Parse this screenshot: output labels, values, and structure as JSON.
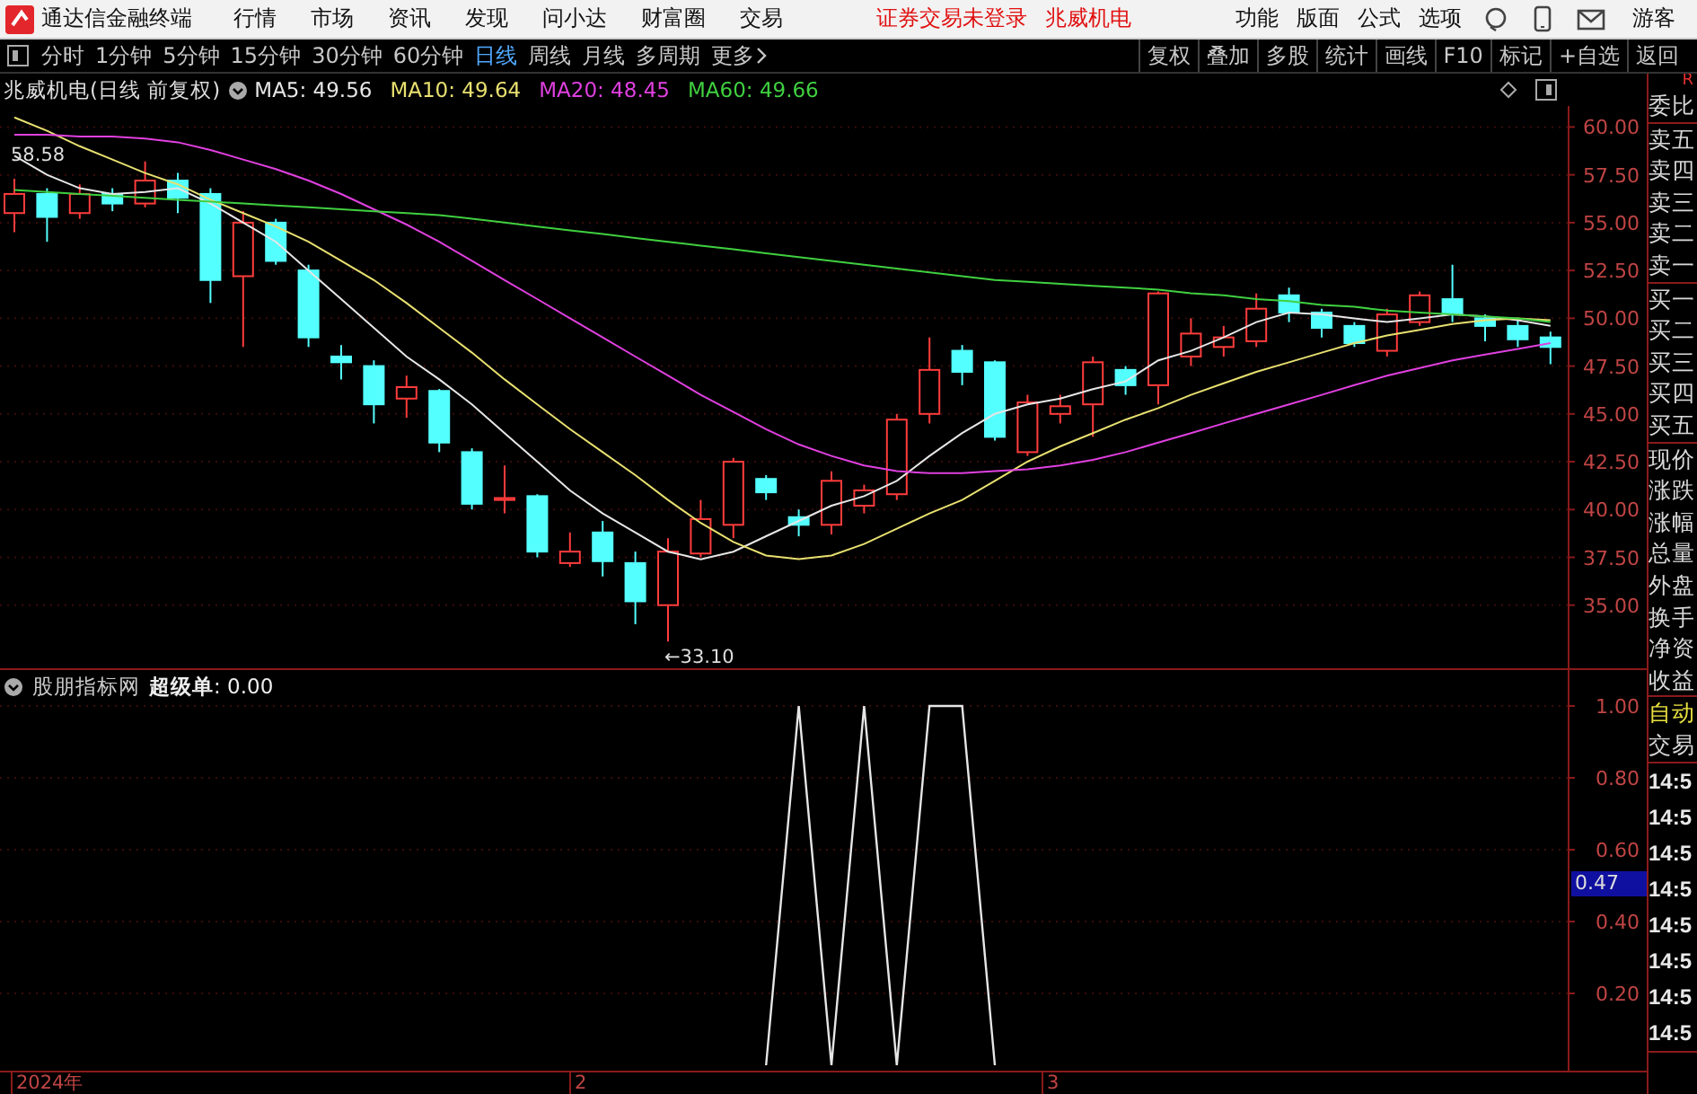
{
  "menubar": {
    "app_title": "通达信金融终端",
    "menus": [
      "行情",
      "市场",
      "资讯",
      "发现",
      "问小达",
      "财富圈",
      "交易"
    ],
    "notices": [
      "证券交易未登录",
      "兆威机电"
    ],
    "right_menus": [
      "功能",
      "版面",
      "公式",
      "选项"
    ],
    "user": "游客"
  },
  "toolbar": {
    "periods": [
      {
        "label": "分时",
        "selected": false
      },
      {
        "label": "1分钟",
        "selected": false
      },
      {
        "label": "5分钟",
        "selected": false
      },
      {
        "label": "15分钟",
        "selected": false
      },
      {
        "label": "30分钟",
        "selected": false
      },
      {
        "label": "60分钟",
        "selected": false
      },
      {
        "label": "日线",
        "selected": true
      },
      {
        "label": "周线",
        "selected": false
      },
      {
        "label": "月线",
        "selected": false
      },
      {
        "label": "多周期",
        "selected": false
      }
    ],
    "more": "更多",
    "actions": [
      "复权",
      "叠加",
      "多股",
      "统计",
      "画线",
      "F10",
      "标记",
      "+自选",
      "返回"
    ]
  },
  "kline": {
    "stock": "兆威机电(日线 前复权)",
    "ma_legend": [
      {
        "text": ": 49.56"
      },
      {
        "text": ": 49.64"
      },
      {
        "text": ": 48.45"
      },
      {
        "text": ": 49.66"
      }
    ],
    "chart_data": {
      "type": "candlestick",
      "ylim": [
        31.7,
        61.1
      ],
      "grid": true,
      "ohlc": [
        [
          55.5,
          57.3,
          54.5,
          56.5
        ],
        [
          56.5,
          56.8,
          54.0,
          55.3
        ],
        [
          55.5,
          57.0,
          55.2,
          56.5
        ],
        [
          56.5,
          56.8,
          55.6,
          56.0
        ],
        [
          56.0,
          58.2,
          55.8,
          57.2
        ],
        [
          57.2,
          57.6,
          55.5,
          56.3
        ],
        [
          56.5,
          56.8,
          50.8,
          52.0
        ],
        [
          52.2,
          55.6,
          48.5,
          55.0
        ],
        [
          55.0,
          55.2,
          52.8,
          53.0
        ],
        [
          52.5,
          52.8,
          48.5,
          49.0
        ],
        [
          48.0,
          48.6,
          46.8,
          47.7
        ],
        [
          47.5,
          47.8,
          44.5,
          45.5
        ],
        [
          45.8,
          47.0,
          44.8,
          46.4
        ],
        [
          46.2,
          46.3,
          43.0,
          43.5
        ],
        [
          43.0,
          43.2,
          40.0,
          40.3
        ],
        [
          40.5,
          42.3,
          39.8,
          40.6
        ],
        [
          40.7,
          40.8,
          37.5,
          37.8
        ],
        [
          37.2,
          38.8,
          37.0,
          37.8
        ],
        [
          38.8,
          39.4,
          36.5,
          37.3
        ],
        [
          37.2,
          37.8,
          34.0,
          35.2
        ],
        [
          35.0,
          38.5,
          33.1,
          37.8
        ],
        [
          37.7,
          40.5,
          37.5,
          39.5
        ],
        [
          39.2,
          42.7,
          38.5,
          42.5
        ],
        [
          41.6,
          41.8,
          40.5,
          40.9
        ],
        [
          39.6,
          40.0,
          38.6,
          39.2
        ],
        [
          39.2,
          42.0,
          38.7,
          41.5
        ],
        [
          40.2,
          41.3,
          39.8,
          41.0
        ],
        [
          40.8,
          45.0,
          40.5,
          44.7
        ],
        [
          45.0,
          49.0,
          44.5,
          47.3
        ],
        [
          48.3,
          48.6,
          46.5,
          47.2
        ],
        [
          47.7,
          47.8,
          43.6,
          43.8
        ],
        [
          43.0,
          46.0,
          42.8,
          45.6
        ],
        [
          45.0,
          46.0,
          44.5,
          45.4
        ],
        [
          45.5,
          48.0,
          43.8,
          47.7
        ],
        [
          47.3,
          47.5,
          46.0,
          46.5
        ],
        [
          46.5,
          51.4,
          45.5,
          51.3
        ],
        [
          48.0,
          50.0,
          47.5,
          49.2
        ],
        [
          48.5,
          49.6,
          48.0,
          49.0
        ],
        [
          48.8,
          51.3,
          48.5,
          50.5
        ],
        [
          51.2,
          51.6,
          49.8,
          50.3
        ],
        [
          50.3,
          50.5,
          49.0,
          49.5
        ],
        [
          49.6,
          49.8,
          48.5,
          48.7
        ],
        [
          48.3,
          50.5,
          48.0,
          50.2
        ],
        [
          49.8,
          51.4,
          49.6,
          51.2
        ],
        [
          51.0,
          52.8,
          49.8,
          50.2
        ],
        [
          50.0,
          50.2,
          48.8,
          49.6
        ],
        [
          49.6,
          50.0,
          48.5,
          48.9
        ],
        [
          49.0,
          49.3,
          47.6,
          48.5
        ]
      ],
      "yticks": [
        {
          "value": 60,
          "label": "60.00"
        },
        {
          "value": 57.5,
          "label": "57.50"
        },
        {
          "value": 55,
          "label": "55.00"
        },
        {
          "value": 52.5,
          "label": "52.50"
        },
        {
          "value": 50,
          "label": "50.00"
        },
        {
          "value": 47.5,
          "label": "47.50"
        },
        {
          "value": 45,
          "label": "45.00"
        },
        {
          "value": 42.5,
          "label": "42.50"
        },
        {
          "value": 40,
          "label": "40.00"
        },
        {
          "value": 37.5,
          "label": "37.50"
        },
        {
          "value": 35,
          "label": "35.00"
        }
      ],
      "series": [
        {
          "name": "MA5",
          "type": "line",
          "color": "#e6e6e6",
          "values": [
            58.5,
            57.5,
            56.8,
            56.5,
            56.6,
            56.8,
            56.0,
            55.0,
            54.0,
            52.5,
            51.0,
            49.5,
            48.0,
            46.8,
            45.5,
            44.0,
            42.5,
            41.0,
            39.8,
            38.8,
            37.8,
            37.4,
            37.8,
            38.6,
            39.4,
            40.2,
            40.7,
            41.5,
            42.8,
            44.0,
            45.0,
            45.5,
            45.8,
            46.3,
            46.7,
            47.8,
            48.3,
            49.0,
            49.8,
            50.3,
            50.2,
            50.0,
            49.8,
            50.0,
            50.2,
            50.1,
            49.9,
            49.6
          ]
        },
        {
          "name": "MA10",
          "type": "line",
          "color": "#e8e070",
          "values": [
            60.5,
            59.8,
            59.0,
            58.3,
            57.6,
            57.0,
            56.2,
            55.5,
            54.8,
            54.0,
            53.0,
            52.0,
            50.8,
            49.5,
            48.2,
            46.8,
            45.5,
            44.2,
            43.0,
            41.8,
            40.5,
            39.3,
            38.3,
            37.6,
            37.4,
            37.6,
            38.2,
            39.0,
            39.8,
            40.5,
            41.5,
            42.5,
            43.3,
            44.0,
            44.7,
            45.3,
            46.0,
            46.6,
            47.2,
            47.7,
            48.2,
            48.7,
            49.1,
            49.4,
            49.7,
            49.9,
            50.0,
            49.9
          ]
        },
        {
          "name": "MA20",
          "type": "line",
          "color": "#e040e0",
          "values": [
            59.6,
            59.6,
            59.5,
            59.5,
            59.4,
            59.2,
            58.8,
            58.3,
            57.8,
            57.2,
            56.5,
            55.7,
            54.9,
            54.0,
            53.0,
            52.0,
            51.0,
            50.0,
            49.0,
            48.0,
            47.0,
            46.0,
            45.1,
            44.2,
            43.4,
            42.8,
            42.3,
            42.0,
            41.9,
            41.9,
            42.0,
            42.1,
            42.3,
            42.6,
            43.0,
            43.5,
            44.0,
            44.5,
            45.0,
            45.5,
            46.0,
            46.5,
            47.0,
            47.4,
            47.8,
            48.1,
            48.4,
            48.7
          ]
        },
        {
          "name": "MA60",
          "type": "line",
          "color": "#40d040",
          "values": [
            56.7,
            56.6,
            56.5,
            56.4,
            56.3,
            56.2,
            56.1,
            56.0,
            55.9,
            55.8,
            55.7,
            55.6,
            55.5,
            55.4,
            55.2,
            55.0,
            54.8,
            54.6,
            54.4,
            54.2,
            54.0,
            53.8,
            53.6,
            53.4,
            53.2,
            53.0,
            52.8,
            52.6,
            52.4,
            52.2,
            52.0,
            51.9,
            51.8,
            51.7,
            51.6,
            51.5,
            51.3,
            51.2,
            51.0,
            50.9,
            50.7,
            50.6,
            50.4,
            50.3,
            50.2,
            50.1,
            50.0,
            49.8
          ]
        }
      ],
      "annotations": [
        {
          "text": "58.58"
        },
        {
          "text": "←33.10"
        }
      ]
    }
  },
  "indicator": {
    "name": "股朋指标网",
    "reading": ": 0.00",
    "cursor_value": "0.47",
    "chart_data": {
      "type": "line",
      "ylim": [
        -0.015,
        1.01
      ],
      "grid": true,
      "yticks": [
        {
          "value": 1,
          "label": "1.00"
        },
        {
          "value": 0.8,
          "label": "0.80"
        },
        {
          "value": 0.6,
          "label": "0.60"
        },
        {
          "value": 0.4,
          "label": "0.40"
        },
        {
          "value": 0.2,
          "label": "0.20"
        }
      ],
      "series": [
        {
          "name": "超级单",
          "color": "#e6e6e6",
          "values": [
            null,
            null,
            null,
            null,
            null,
            null,
            null,
            null,
            null,
            null,
            null,
            null,
            null,
            null,
            null,
            null,
            null,
            null,
            null,
            null,
            null,
            null,
            null,
            0,
            1,
            0,
            1,
            0,
            1,
            1,
            0,
            null,
            null,
            null,
            null,
            null,
            null,
            null,
            null,
            null,
            null,
            null,
            null,
            null,
            null,
            null,
            null,
            null
          ]
        }
      ]
    }
  },
  "time_axis": [
    "2024年",
    "2",
    "3"
  ],
  "side_panel": {
    "header": "R",
    "groups": [
      [
        {
          "text": "委比",
          "kind": "label"
        }
      ],
      [
        {
          "text": "卖五",
          "kind": "label"
        },
        {
          "text": "卖四",
          "kind": "label"
        },
        {
          "text": "卖三",
          "kind": "label"
        },
        {
          "text": "卖二",
          "kind": "label"
        },
        {
          "text": "卖一",
          "kind": "label"
        }
      ],
      [
        {
          "text": "买一",
          "kind": "label"
        },
        {
          "text": "买二",
          "kind": "label"
        },
        {
          "text": "买三",
          "kind": "label"
        },
        {
          "text": "买四",
          "kind": "label"
        },
        {
          "text": "买五",
          "kind": "label"
        }
      ],
      [
        {
          "text": "现价",
          "kind": "label"
        },
        {
          "text": "涨跌",
          "kind": "label"
        },
        {
          "text": "涨幅",
          "kind": "label"
        },
        {
          "text": "总量",
          "kind": "label"
        },
        {
          "text": "外盘",
          "kind": "label"
        },
        {
          "text": "换手",
          "kind": "label"
        },
        {
          "text": "净资",
          "kind": "label"
        },
        {
          "text": "收益",
          "kind": "label"
        }
      ],
      [
        {
          "text": "自动",
          "kind": "status"
        },
        {
          "text": "交易",
          "kind": "label"
        }
      ],
      [
        {
          "text": "14:5",
          "kind": "time"
        },
        {
          "text": "14:5",
          "kind": "time"
        },
        {
          "text": "14:5",
          "kind": "time"
        },
        {
          "text": "14:5",
          "kind": "time"
        },
        {
          "text": "14:5",
          "kind": "time"
        },
        {
          "text": "14:5",
          "kind": "time"
        },
        {
          "text": "14:5",
          "kind": "time"
        },
        {
          "text": "14:5",
          "kind": "time"
        }
      ]
    ]
  }
}
